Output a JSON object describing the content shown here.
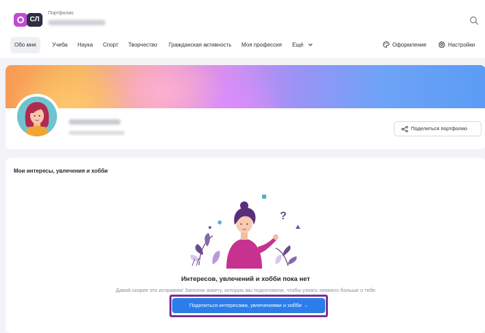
{
  "header": {
    "logo_text": "СЛ",
    "app_label": "Портфолио",
    "search_icon": "search-icon"
  },
  "nav": {
    "items": [
      {
        "label": "Обо мне",
        "active": true
      },
      {
        "label": "Учеба"
      },
      {
        "label": "Наука"
      },
      {
        "label": "Спорт"
      },
      {
        "label": "Творчество"
      },
      {
        "label": "Гражданская активность"
      },
      {
        "label": "Моя профессия"
      },
      {
        "label": "Ещё"
      }
    ],
    "design_label": "Оформление",
    "settings_label": "Настройки"
  },
  "profile": {
    "share_label": "Поделиться портфолио"
  },
  "interests": {
    "title": "Мои интересы, увлечения и хобби",
    "empty_title": "Интересов, увлечений и хобби пока нет",
    "empty_text": "Давай скорее это исправим! Заполни анкету, которую мы подготовили, чтобы узнать немного больше о тебе",
    "cta_label": "Поделиться интересами, увлечениями и хобби →"
  },
  "colors": {
    "accent": "#2b7de9",
    "highlight_frame": "#7a2f8e",
    "logo_purple": "#c04bd6",
    "logo_dark": "#2e2f44"
  }
}
